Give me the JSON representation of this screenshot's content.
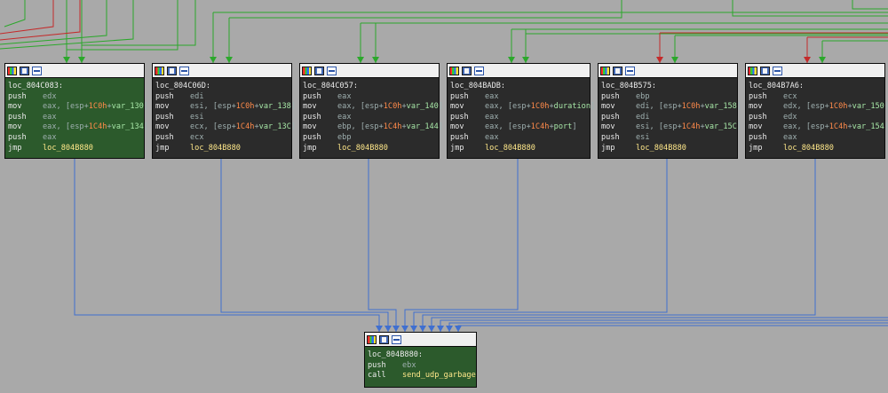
{
  "window": {
    "background": "#a9a9a9"
  },
  "colors": {
    "green_edge": "#2ba82b",
    "red_edge": "#c42a2a",
    "blue_edge": "#3f6fd0",
    "block_bg": "#2b2b2b",
    "selected_bg": "#2c5a2c"
  },
  "blocks": [
    {
      "label": "loc_804C083:",
      "selected": true,
      "lines": [
        {
          "mnem": "push",
          "ops": [
            {
              "t": "edx",
              "k": "reg"
            }
          ]
        },
        {
          "mnem": "mov",
          "ops": [
            {
              "t": "eax, [esp+",
              "k": "mem"
            },
            {
              "t": "1C0h",
              "k": "num"
            },
            {
              "t": "+",
              "k": "mem"
            },
            {
              "t": "var_130",
              "k": "var"
            },
            {
              "t": "]",
              "k": "mem"
            }
          ]
        },
        {
          "mnem": "push",
          "ops": [
            {
              "t": "eax",
              "k": "reg"
            }
          ]
        },
        {
          "mnem": "mov",
          "ops": [
            {
              "t": "eax, [esp+",
              "k": "mem"
            },
            {
              "t": "1C4h",
              "k": "num"
            },
            {
              "t": "+",
              "k": "mem"
            },
            {
              "t": "var_134",
              "k": "var"
            },
            {
              "t": "]",
              "k": "mem"
            }
          ]
        },
        {
          "mnem": "push",
          "ops": [
            {
              "t": "eax",
              "k": "reg"
            }
          ]
        },
        {
          "mnem": "jmp",
          "ops": [
            {
              "t": "loc_804B880",
              "k": "sym"
            }
          ]
        }
      ]
    },
    {
      "label": "loc_804C06D:",
      "selected": false,
      "lines": [
        {
          "mnem": "push",
          "ops": [
            {
              "t": "edi",
              "k": "reg"
            }
          ]
        },
        {
          "mnem": "mov",
          "ops": [
            {
              "t": "esi, [esp+",
              "k": "mem"
            },
            {
              "t": "1C0h",
              "k": "num"
            },
            {
              "t": "+",
              "k": "mem"
            },
            {
              "t": "var_138",
              "k": "var"
            },
            {
              "t": "]",
              "k": "mem"
            }
          ]
        },
        {
          "mnem": "push",
          "ops": [
            {
              "t": "esi",
              "k": "reg"
            }
          ]
        },
        {
          "mnem": "mov",
          "ops": [
            {
              "t": "ecx, [esp+",
              "k": "mem"
            },
            {
              "t": "1C4h",
              "k": "num"
            },
            {
              "t": "+",
              "k": "mem"
            },
            {
              "t": "var_13C",
              "k": "var"
            },
            {
              "t": "]",
              "k": "mem"
            }
          ]
        },
        {
          "mnem": "push",
          "ops": [
            {
              "t": "ecx",
              "k": "reg"
            }
          ]
        },
        {
          "mnem": "jmp",
          "ops": [
            {
              "t": "loc_804B880",
              "k": "sym"
            }
          ]
        }
      ]
    },
    {
      "label": "loc_804C057:",
      "selected": false,
      "lines": [
        {
          "mnem": "push",
          "ops": [
            {
              "t": "eax",
              "k": "reg"
            }
          ]
        },
        {
          "mnem": "mov",
          "ops": [
            {
              "t": "eax, [esp+",
              "k": "mem"
            },
            {
              "t": "1C0h",
              "k": "num"
            },
            {
              "t": "+",
              "k": "mem"
            },
            {
              "t": "var_140",
              "k": "var"
            },
            {
              "t": "]",
              "k": "mem"
            }
          ]
        },
        {
          "mnem": "push",
          "ops": [
            {
              "t": "eax",
              "k": "reg"
            }
          ]
        },
        {
          "mnem": "mov",
          "ops": [
            {
              "t": "ebp, [esp+",
              "k": "mem"
            },
            {
              "t": "1C4h",
              "k": "num"
            },
            {
              "t": "+",
              "k": "mem"
            },
            {
              "t": "var_144",
              "k": "var"
            },
            {
              "t": "]",
              "k": "mem"
            }
          ]
        },
        {
          "mnem": "push",
          "ops": [
            {
              "t": "ebp",
              "k": "reg"
            }
          ]
        },
        {
          "mnem": "jmp",
          "ops": [
            {
              "t": "loc_804B880",
              "k": "sym"
            }
          ]
        }
      ]
    },
    {
      "label": "loc_804BADB:",
      "selected": false,
      "lines": [
        {
          "mnem": "push",
          "ops": [
            {
              "t": "eax",
              "k": "reg"
            }
          ]
        },
        {
          "mnem": "mov",
          "ops": [
            {
              "t": "eax, [esp+",
              "k": "mem"
            },
            {
              "t": "1C0h",
              "k": "num"
            },
            {
              "t": "+",
              "k": "mem"
            },
            {
              "t": "duration",
              "k": "var"
            },
            {
              "t": "]",
              "k": "mem"
            }
          ]
        },
        {
          "mnem": "push",
          "ops": [
            {
              "t": "eax",
              "k": "reg"
            }
          ]
        },
        {
          "mnem": "mov",
          "ops": [
            {
              "t": "eax, [esp+",
              "k": "mem"
            },
            {
              "t": "1C4h",
              "k": "num"
            },
            {
              "t": "+",
              "k": "mem"
            },
            {
              "t": "port",
              "k": "var"
            },
            {
              "t": "]",
              "k": "mem"
            }
          ]
        },
        {
          "mnem": "push",
          "ops": [
            {
              "t": "eax",
              "k": "reg"
            }
          ]
        },
        {
          "mnem": "jmp",
          "ops": [
            {
              "t": "loc_804B880",
              "k": "sym"
            }
          ]
        }
      ]
    },
    {
      "label": "loc_804B575:",
      "selected": false,
      "lines": [
        {
          "mnem": "push",
          "ops": [
            {
              "t": "ebp",
              "k": "reg"
            }
          ]
        },
        {
          "mnem": "mov",
          "ops": [
            {
              "t": "edi, [esp+",
              "k": "mem"
            },
            {
              "t": "1C0h",
              "k": "num"
            },
            {
              "t": "+",
              "k": "mem"
            },
            {
              "t": "var_158",
              "k": "var"
            },
            {
              "t": "]",
              "k": "mem"
            }
          ]
        },
        {
          "mnem": "push",
          "ops": [
            {
              "t": "edi",
              "k": "reg"
            }
          ]
        },
        {
          "mnem": "mov",
          "ops": [
            {
              "t": "esi, [esp+",
              "k": "mem"
            },
            {
              "t": "1C4h",
              "k": "num"
            },
            {
              "t": "+",
              "k": "mem"
            },
            {
              "t": "var_15C",
              "k": "var"
            },
            {
              "t": "]",
              "k": "mem"
            }
          ]
        },
        {
          "mnem": "push",
          "ops": [
            {
              "t": "esi",
              "k": "reg"
            }
          ]
        },
        {
          "mnem": "jmp",
          "ops": [
            {
              "t": "loc_804B880",
              "k": "sym"
            }
          ]
        }
      ]
    },
    {
      "label": "loc_804B7A6:",
      "selected": false,
      "lines": [
        {
          "mnem": "push",
          "ops": [
            {
              "t": "ecx",
              "k": "reg"
            }
          ]
        },
        {
          "mnem": "mov",
          "ops": [
            {
              "t": "edx, [esp+",
              "k": "mem"
            },
            {
              "t": "1C0h",
              "k": "num"
            },
            {
              "t": "+",
              "k": "mem"
            },
            {
              "t": "var_150",
              "k": "var"
            },
            {
              "t": "]",
              "k": "mem"
            }
          ]
        },
        {
          "mnem": "push",
          "ops": [
            {
              "t": "edx",
              "k": "reg"
            }
          ]
        },
        {
          "mnem": "mov",
          "ops": [
            {
              "t": "eax, [esp+",
              "k": "mem"
            },
            {
              "t": "1C4h",
              "k": "num"
            },
            {
              "t": "+",
              "k": "mem"
            },
            {
              "t": "var_154",
              "k": "var"
            },
            {
              "t": "]",
              "k": "mem"
            }
          ]
        },
        {
          "mnem": "push",
          "ops": [
            {
              "t": "eax",
              "k": "reg"
            }
          ]
        },
        {
          "mnem": "jmp",
          "ops": [
            {
              "t": "loc_804B880",
              "k": "sym"
            }
          ]
        }
      ]
    },
    {
      "label": "loc_804B880:",
      "selected": true,
      "lines": [
        {
          "mnem": "push",
          "ops": [
            {
              "t": "ebx",
              "k": "reg"
            }
          ]
        },
        {
          "mnem": "call",
          "ops": [
            {
              "t": "send_udp_garbage",
              "k": "sym"
            }
          ]
        }
      ]
    }
  ]
}
